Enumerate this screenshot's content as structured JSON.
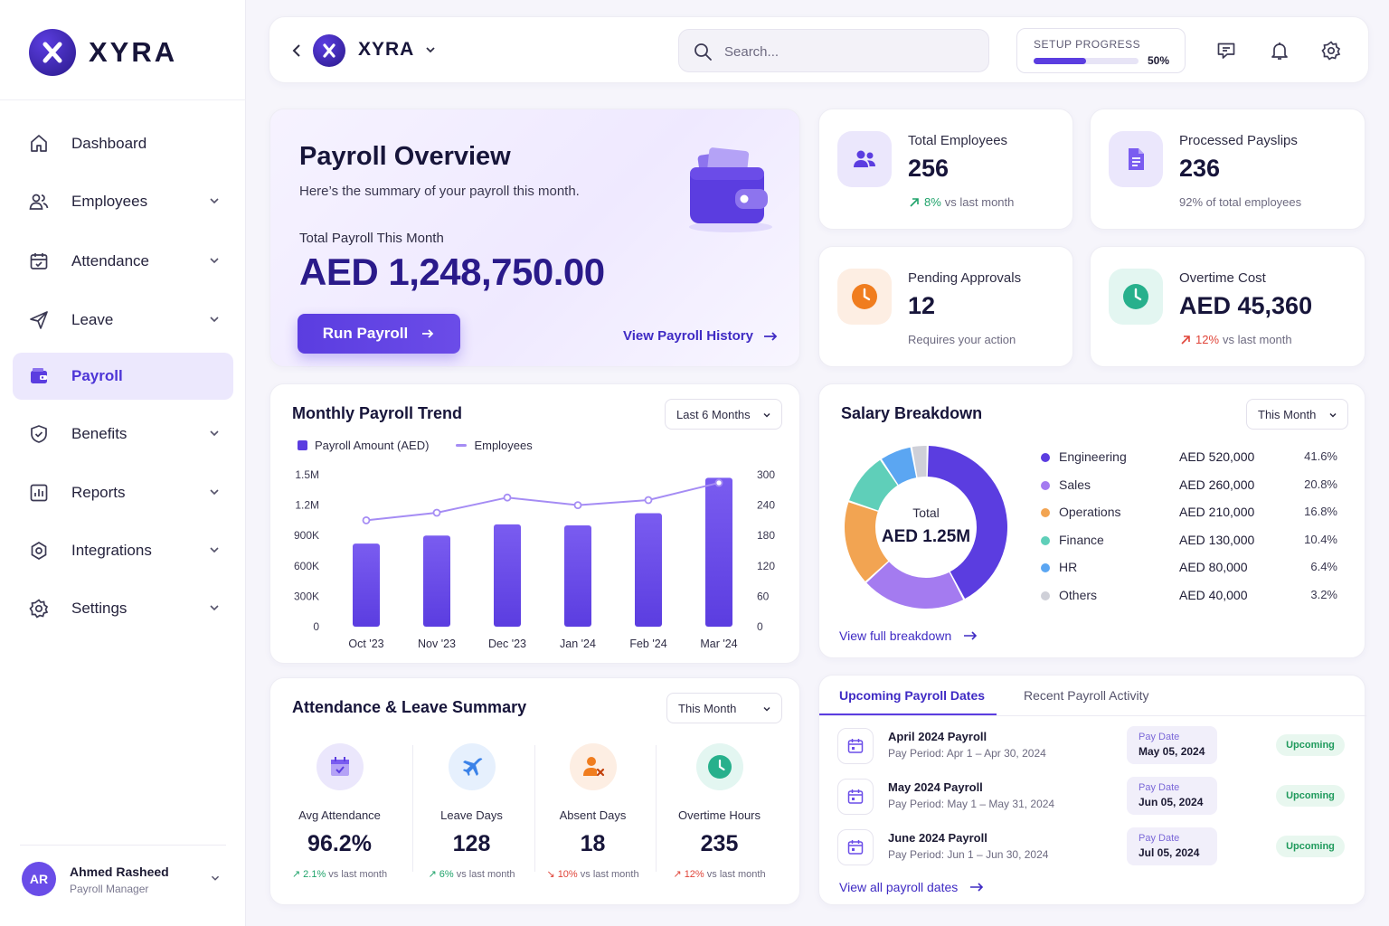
{
  "app": {
    "brand": "XYRA"
  },
  "sidebar": {
    "items": [
      {
        "label": "Dashboard",
        "icon": "home-icon"
      },
      {
        "label": "Employees",
        "icon": "users-icon"
      },
      {
        "label": "Attendance",
        "icon": "calendar-icon"
      },
      {
        "label": "Leave",
        "icon": "plane-icon"
      },
      {
        "label": "Payroll",
        "icon": "wallet-icon",
        "active": true
      },
      {
        "label": "Benefits",
        "icon": "shield-icon"
      },
      {
        "label": "Reports",
        "icon": "bar-chart-icon"
      },
      {
        "label": "Integrations",
        "icon": "puzzle-icon"
      },
      {
        "label": "Settings",
        "icon": "gear-icon"
      }
    ],
    "user": {
      "initials": "AR",
      "name": "Ahmed Rasheed",
      "role": "Payroll Manager"
    }
  },
  "topbar": {
    "brand": "XYRA",
    "search_placeholder": "Search...",
    "setup_label": "SETUP PROGRESS",
    "setup_percent_text": "50%",
    "setup_progress": 0.5
  },
  "overview": {
    "title": "Payroll Overview",
    "subtitle": "Here’s the summary of your payroll this month.",
    "total_label": "Total Payroll This Month",
    "total_amount": "AED 1,248,750.00",
    "run_label": "Run Payroll",
    "history_label": "View Payroll History"
  },
  "stats": {
    "employees": {
      "label": "Total Employees",
      "value": "256",
      "change": "8%",
      "change_suffix": "vs last month"
    },
    "payslips": {
      "label": "Processed Payslips",
      "value": "236",
      "note": "92% of total employees"
    },
    "approvals": {
      "label": "Pending Approvals",
      "value": "12",
      "note": "Requires your action"
    },
    "overtime": {
      "label": "Overtime Cost",
      "value": "AED 45,360",
      "change": "12%",
      "change_suffix": "vs last month"
    }
  },
  "trend": {
    "title": "Monthly Payroll Trend",
    "range": "Last 6 Months",
    "legend_amount": "Payroll Amount (AED)",
    "legend_employees": "Employees"
  },
  "chart_data": {
    "type": "bar",
    "categories": [
      "Oct '23",
      "Nov '23",
      "Dec '23",
      "Jan '24",
      "Feb '24",
      "Mar '24"
    ],
    "series": [
      {
        "name": "Payroll Amount (AED)",
        "type": "bar",
        "axis": "left",
        "values": [
          820000,
          900000,
          1010000,
          1000000,
          1120000,
          1470000
        ]
      },
      {
        "name": "Employees",
        "type": "line",
        "axis": "right",
        "values": [
          210,
          225,
          255,
          240,
          250,
          284
        ]
      }
    ],
    "y_left": {
      "ticks": [
        "0",
        "300K",
        "600K",
        "900K",
        "1.2M",
        "1.5M"
      ],
      "range": [
        0,
        1500000
      ]
    },
    "y_right": {
      "ticks": [
        "0",
        "60",
        "120",
        "180",
        "240",
        "300"
      ],
      "range": [
        0,
        300
      ]
    },
    "legend_position": "top-left",
    "grid": false
  },
  "salary": {
    "title": "Salary Breakdown",
    "range": "This Month",
    "total_label": "Total",
    "total_value": "AED 1.25M",
    "items": [
      {
        "name": "Engineering",
        "amount": "AED 520,000",
        "pct": "41.6%",
        "value": 41.6,
        "color": "#5b3de0"
      },
      {
        "name": "Sales",
        "amount": "AED 260,000",
        "pct": "20.8%",
        "value": 20.8,
        "color": "#a47bf0"
      },
      {
        "name": "Operations",
        "amount": "AED 210,000",
        "pct": "16.8%",
        "value": 16.8,
        "color": "#f2a452"
      },
      {
        "name": "Finance",
        "amount": "AED 130,000",
        "pct": "10.4%",
        "value": 10.4,
        "color": "#5fcfb9"
      },
      {
        "name": "HR",
        "amount": "AED 80,000",
        "pct": "6.4%",
        "value": 6.4,
        "color": "#5ba6f2"
      },
      {
        "name": "Others",
        "amount": "AED 40,000",
        "pct": "3.2%",
        "value": 3.2,
        "color": "#cfd0d8"
      }
    ],
    "link": "View full breakdown"
  },
  "attendance": {
    "title": "Attendance & Leave Summary",
    "range": "This Month",
    "items": [
      {
        "label": "Avg Attendance",
        "value": "96.2%",
        "change": "2.1%",
        "suffix": "vs last month",
        "dir": "up"
      },
      {
        "label": "Leave Days",
        "value": "128",
        "change": "6%",
        "suffix": "vs last month",
        "dir": "up"
      },
      {
        "label": "Absent Days",
        "value": "18",
        "change": "10%",
        "suffix": "vs last month",
        "dir": "down"
      },
      {
        "label": "Overtime Hours",
        "value": "235",
        "change": "12%",
        "suffix": "vs last month",
        "dir": "up"
      }
    ]
  },
  "payroll_dates": {
    "tab_upcoming": "Upcoming Payroll Dates",
    "tab_recent": "Recent Payroll Activity",
    "rows": [
      {
        "title": "April 2024 Payroll",
        "period": "Pay Period: Apr 1 – Apr 30, 2024",
        "date_label": "Pay Date",
        "date": "May 05, 2024",
        "status": "Upcoming"
      },
      {
        "title": "May 2024 Payroll",
        "period": "Pay Period: May 1 – May 31, 2024",
        "date_label": "Pay Date",
        "date": "Jun 05, 2024",
        "status": "Upcoming"
      },
      {
        "title": "June 2024 Payroll",
        "period": "Pay Period: Jun 1 – Jun 30, 2024",
        "date_label": "Pay Date",
        "date": "Jul 05, 2024",
        "status": "Upcoming"
      }
    ],
    "link": "View all payroll dates"
  }
}
